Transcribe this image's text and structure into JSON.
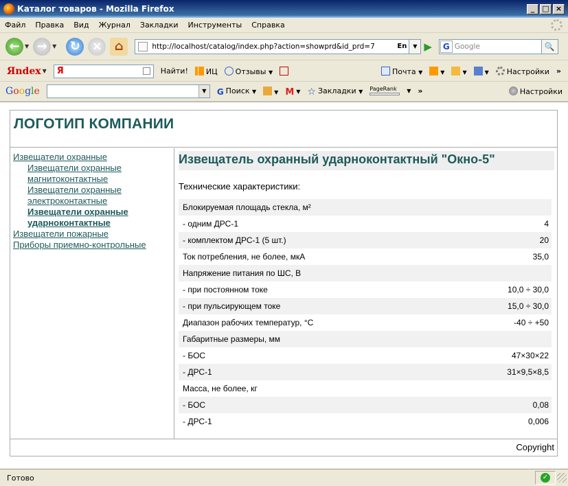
{
  "window": {
    "title": "Каталог товаров - Mozilla Firefox"
  },
  "menu": [
    "Файл",
    "Правка",
    "Вид",
    "Журнал",
    "Закладки",
    "Инструменты",
    "Справка"
  ],
  "nav": {
    "url": "http://localhost/catalog/index.php?action=showprd&id_prd=7",
    "lang": "En",
    "search_placeholder": "Google"
  },
  "yandex_bar": {
    "logo": "Яndex",
    "input_prefix": "Я",
    "find": "Найти!",
    "ic": "ИЦ",
    "reviews": "Отзывы",
    "mail": "Почта",
    "settings": "Настройки"
  },
  "google_bar": {
    "logo": "Google",
    "search": "Поиск",
    "bookmarks": "Закладки",
    "pagerank": "PageRank",
    "settings": "Настройки"
  },
  "page": {
    "logo": "ЛОГОТИП КОМПАНИИ",
    "sidebar": [
      {
        "label": "Извещатели охранные",
        "level": 0,
        "active": false
      },
      {
        "label": "Извещатели охранные магнитоконтактные",
        "level": 1,
        "active": false
      },
      {
        "label": "Извещатели охранные электроконтактные",
        "level": 1,
        "active": false
      },
      {
        "label": "Извещатели охранные ударноконтактные",
        "level": 1,
        "active": true
      },
      {
        "label": "Извещатели пожарные",
        "level": 0,
        "active": false
      },
      {
        "label": "Приборы приемно-контрольные",
        "level": 0,
        "active": false
      }
    ],
    "product_title": "Извещатель охранный ударноконтактный \"Окно-5\"",
    "specs_heading": "Технические характеристики:",
    "specs": [
      [
        "Блокируемая площадь стекла, м²",
        ""
      ],
      [
        "- одним ДРС-1",
        "4"
      ],
      [
        "- комплектом ДРС-1 (5 шт.)",
        "20"
      ],
      [
        "Ток потребления, не более, мкА",
        "35,0"
      ],
      [
        "Напряжение питания по ШС, В",
        ""
      ],
      [
        "- при постоянном токе",
        "10,0 ÷ 30,0"
      ],
      [
        "- при пульсирующем токе",
        "15,0 ÷ 30,0"
      ],
      [
        "Диапазон рабочих температур, °С",
        "-40 ÷ +50"
      ],
      [
        "Габаритные размеры, мм",
        ""
      ],
      [
        "- БОС",
        "47×30×22"
      ],
      [
        "- ДРС-1",
        "31×9,5×8,5"
      ],
      [
        "Масса, не более, кг",
        ""
      ],
      [
        "- БОС",
        "0,08"
      ],
      [
        "- ДРС-1",
        "0,006"
      ]
    ],
    "footer": "Copyright"
  },
  "status": {
    "text": "Готово"
  }
}
